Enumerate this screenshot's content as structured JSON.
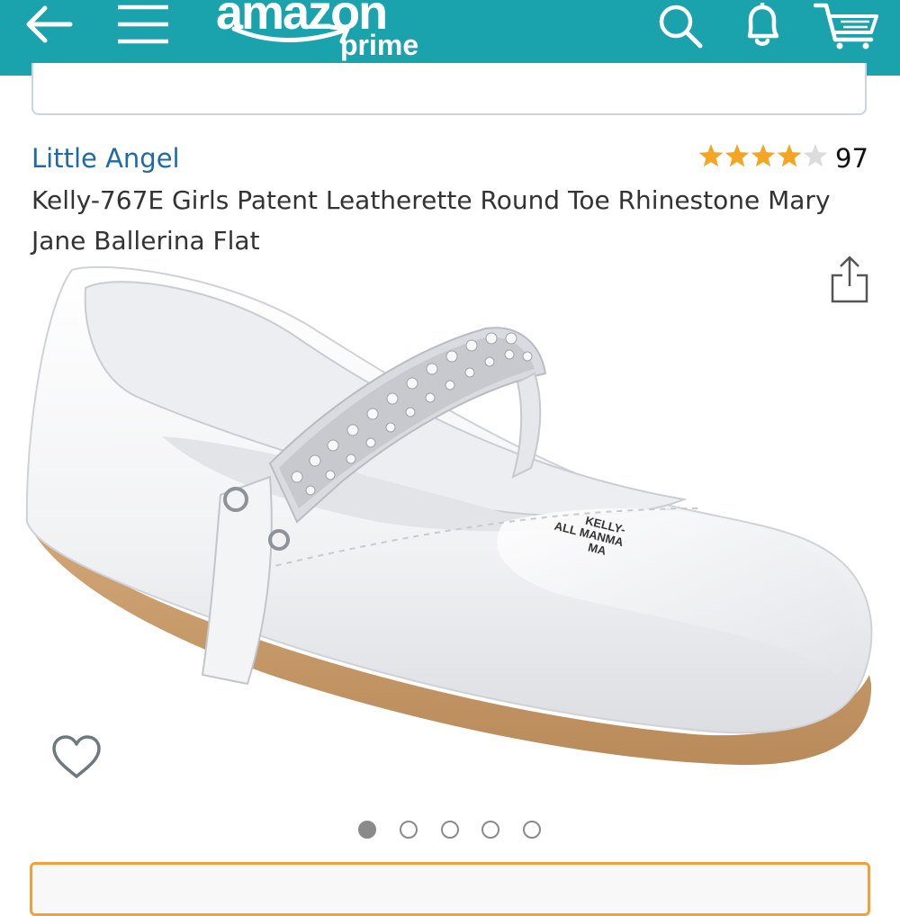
{
  "header": {
    "background_color": "#1ba3ad",
    "back_icon": "arrow-left-icon",
    "menu_icon": "hamburger-menu-icon",
    "logo_word": "amazon",
    "logo_sub": "prime",
    "search_icon": "search-icon",
    "notifications_icon": "bell-icon",
    "cart_icon": "cart-icon"
  },
  "product": {
    "brand": "Little Angel",
    "brand_color": "#1f6aa6",
    "rating_stars": 4,
    "rating_max": 5,
    "rating_count": "97",
    "title": "Kelly-767E Girls Patent Leatherette Round Toe Rhinestone Mary Jane Ballerina Flat",
    "image_label_lines": [
      "KELLY-",
      "ALL MANMA",
      "MA"
    ],
    "share_icon": "share-icon",
    "wishlist_icon": "heart-outline-icon"
  },
  "gallery": {
    "total": 5,
    "active_index": 0
  },
  "accent_colors": {
    "star": "#f4a623",
    "buy_box_border": "#f0a23a"
  }
}
